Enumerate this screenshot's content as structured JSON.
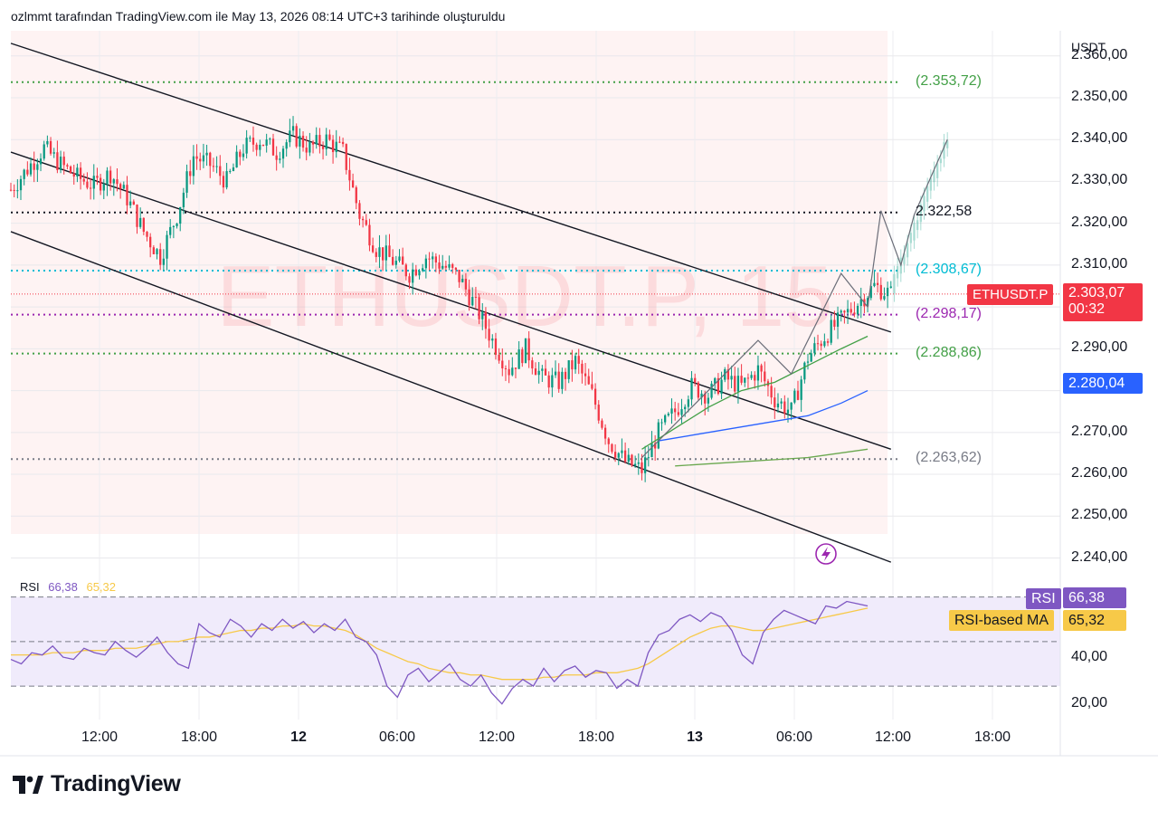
{
  "header": {
    "caption": "ozlmmt tarafından TradingView.com ile May 13, 2026 08:14 UTC+3 tarihinde oluşturuldu"
  },
  "brand": {
    "name": "TradingView",
    "icon": "tradingview-logo-icon"
  },
  "watermark": {
    "text": "ETHUSDT.P, 15"
  },
  "colors": {
    "up": "#089981",
    "down": "#f23645",
    "pink_bg": "#fde9e9",
    "rsi_line": "#7e57c2",
    "rsi_ma": "#f7c948",
    "rsi_band": "#f0ebfb",
    "ma_green": "#43a047",
    "ma_blue": "#2962ff",
    "ma_olive": "#6aa84f"
  },
  "price_axis": {
    "currency": "USDT",
    "ticks": [
      "2.360,00",
      "2.350,00",
      "2.340,00",
      "2.330,00",
      "2.320,00",
      "2.310,00",
      "2.290,00",
      "2.270,00",
      "2.260,00",
      "2.250,00",
      "2.240,00"
    ],
    "current_symbol": "ETHUSDT.P",
    "current_price": "2.303,07",
    "countdown": "00:32",
    "blue_marker": "2.280,04"
  },
  "levels": [
    {
      "label": "(2.353,72)",
      "price": 2353.72,
      "color": "#43a047"
    },
    {
      "label": "2.322,58",
      "price": 2322.58,
      "color": "#131722"
    },
    {
      "label": "(2.308,67)",
      "price": 2308.67,
      "color": "#00bcd4"
    },
    {
      "label": "(2.298,17)",
      "price": 2298.17,
      "color": "#9c27b0"
    },
    {
      "label": "(2.288,86)",
      "price": 2288.86,
      "color": "#43a047"
    },
    {
      "label": "(2.263,62)",
      "price": 2263.62,
      "color": "#787b86"
    }
  ],
  "time_axis": {
    "ticks": [
      "12:00",
      "18:00",
      "12",
      "06:00",
      "12:00",
      "18:00",
      "13",
      "06:00",
      "12:00",
      "18:00"
    ]
  },
  "rsi": {
    "label": "RSI",
    "value": "66,38",
    "ma_value": "65,32",
    "ma_label": "RSI-based MA",
    "ticks": [
      "40,00",
      "20,00"
    ]
  },
  "chart_data": [
    {
      "type": "candlestick",
      "symbol": "ETHUSDT.P",
      "interval": "15",
      "ylim": [
        2236,
        2366
      ],
      "x_ticks": [
        "12:00",
        "18:00",
        "12",
        "06:00",
        "12:00",
        "18:00",
        "13",
        "06:00",
        "12:00",
        "18:00"
      ],
      "close_path": [
        {
          "t": 0,
          "price": 2328
        },
        {
          "t": 5,
          "price": 2333
        },
        {
          "t": 10,
          "price": 2338
        },
        {
          "t": 15,
          "price": 2334
        },
        {
          "t": 20,
          "price": 2331
        },
        {
          "t": 25,
          "price": 2329
        },
        {
          "t": 30,
          "price": 2332
        },
        {
          "t": 35,
          "price": 2326
        },
        {
          "t": 40,
          "price": 2318
        },
        {
          "t": 45,
          "price": 2312
        },
        {
          "t": 50,
          "price": 2322
        },
        {
          "t": 55,
          "price": 2336
        },
        {
          "t": 60,
          "price": 2334
        },
        {
          "t": 65,
          "price": 2330
        },
        {
          "t": 70,
          "price": 2338
        },
        {
          "t": 75,
          "price": 2340
        },
        {
          "t": 80,
          "price": 2337
        },
        {
          "t": 85,
          "price": 2341
        },
        {
          "t": 90,
          "price": 2338
        },
        {
          "t": 95,
          "price": 2340
        },
        {
          "t": 100,
          "price": 2337
        },
        {
          "t": 105,
          "price": 2322
        },
        {
          "t": 110,
          "price": 2314
        },
        {
          "t": 115,
          "price": 2311
        },
        {
          "t": 120,
          "price": 2308
        },
        {
          "t": 125,
          "price": 2312
        },
        {
          "t": 130,
          "price": 2310
        },
        {
          "t": 135,
          "price": 2307
        },
        {
          "t": 140,
          "price": 2300
        },
        {
          "t": 145,
          "price": 2292
        },
        {
          "t": 150,
          "price": 2285
        },
        {
          "t": 155,
          "price": 2290
        },
        {
          "t": 160,
          "price": 2283
        },
        {
          "t": 165,
          "price": 2282
        },
        {
          "t": 170,
          "price": 2287
        },
        {
          "t": 175,
          "price": 2279
        },
        {
          "t": 180,
          "price": 2268
        },
        {
          "t": 185,
          "price": 2263
        },
        {
          "t": 190,
          "price": 2261
        },
        {
          "t": 195,
          "price": 2270
        },
        {
          "t": 200,
          "price": 2275
        },
        {
          "t": 205,
          "price": 2281
        },
        {
          "t": 210,
          "price": 2279
        },
        {
          "t": 215,
          "price": 2283
        },
        {
          "t": 220,
          "price": 2281
        },
        {
          "t": 225,
          "price": 2285
        },
        {
          "t": 230,
          "price": 2278
        },
        {
          "t": 235,
          "price": 2275
        },
        {
          "t": 240,
          "price": 2288
        },
        {
          "t": 245,
          "price": 2293
        },
        {
          "t": 250,
          "price": 2297
        },
        {
          "t": 255,
          "price": 2301
        },
        {
          "t": 260,
          "price": 2305
        },
        {
          "t": 265,
          "price": 2303
        }
      ],
      "ma_lines": [
        {
          "name": "",
          "color": "#43a047",
          "points": [
            [
              190,
              2266
            ],
            [
              200,
              2271
            ],
            [
              210,
              2276
            ],
            [
              220,
              2280
            ],
            [
              230,
              2282
            ],
            [
              240,
              2286
            ],
            [
              250,
              2290
            ],
            [
              258,
              2293
            ]
          ]
        },
        {
          "name": "",
          "color": "#2962ff",
          "points": [
            [
              195,
              2268
            ],
            [
              210,
              2270
            ],
            [
              225,
              2272
            ],
            [
              240,
              2274
            ],
            [
              250,
              2277
            ],
            [
              258,
              2280
            ]
          ]
        },
        {
          "name": "",
          "color": "#6aa84f",
          "points": [
            [
              200,
              2262
            ],
            [
              220,
              2263
            ],
            [
              240,
              2264
            ],
            [
              258,
              2266
            ]
          ]
        }
      ],
      "channel_lines": [
        {
          "start": [
            0,
            2363
          ],
          "end": [
            265,
            2294
          ]
        },
        {
          "start": [
            0,
            2337
          ],
          "end": [
            265,
            2266
          ]
        },
        {
          "start": [
            0,
            2318
          ],
          "end": [
            265,
            2239
          ]
        }
      ],
      "projection_zigzag": [
        [
          190,
          2264
        ],
        [
          225,
          2292
        ],
        [
          235,
          2284
        ],
        [
          250,
          2308
        ],
        [
          258,
          2300
        ],
        [
          262,
          2323
        ],
        [
          268,
          2310
        ],
        [
          272,
          2322
        ],
        [
          282,
          2340
        ]
      ],
      "levels": [
        2353.72,
        2322.58,
        2308.67,
        2298.17,
        2288.86,
        2263.62
      ]
    },
    {
      "type": "line",
      "name": "RSI",
      "ylim": [
        15,
        80
      ],
      "y_ticks": [
        40,
        20
      ],
      "bands": [
        70,
        50,
        30
      ],
      "series": [
        {
          "name": "RSI",
          "values": [
            42,
            40,
            45,
            44,
            48,
            43,
            42,
            47,
            45,
            44,
            50,
            46,
            43,
            47,
            52,
            45,
            40,
            38,
            58,
            54,
            52,
            60,
            57,
            52,
            58,
            55,
            60,
            56,
            59,
            54,
            58,
            55,
            60,
            52,
            50,
            44,
            30,
            25,
            35,
            38,
            32,
            36,
            40,
            33,
            30,
            35,
            27,
            22,
            29,
            33,
            30,
            38,
            32,
            37,
            39,
            34,
            37,
            36,
            29,
            33,
            30,
            45,
            53,
            55,
            60,
            62,
            59,
            63,
            61,
            55,
            44,
            40,
            54,
            60,
            64,
            62,
            60,
            58,
            66,
            65,
            68,
            67,
            66
          ]
        },
        {
          "name": "RSI-based MA",
          "values": [
            44,
            44,
            44,
            44,
            45,
            45,
            45,
            46,
            46,
            46,
            47,
            47,
            47,
            48,
            49,
            50,
            50,
            51,
            52,
            52,
            53,
            54,
            55,
            55,
            56,
            56,
            57,
            57,
            58,
            57,
            57,
            56,
            55,
            53,
            50,
            47,
            45,
            43,
            41,
            40,
            38,
            37,
            36,
            36,
            35,
            35,
            34,
            33,
            33,
            33,
            33,
            34,
            34,
            35,
            35,
            35,
            36,
            36,
            36,
            37,
            38,
            40,
            43,
            46,
            49,
            52,
            54,
            56,
            57,
            57,
            56,
            55,
            55,
            56,
            57,
            58,
            59,
            60,
            61,
            62,
            63,
            64,
            65
          ]
        }
      ]
    }
  ]
}
